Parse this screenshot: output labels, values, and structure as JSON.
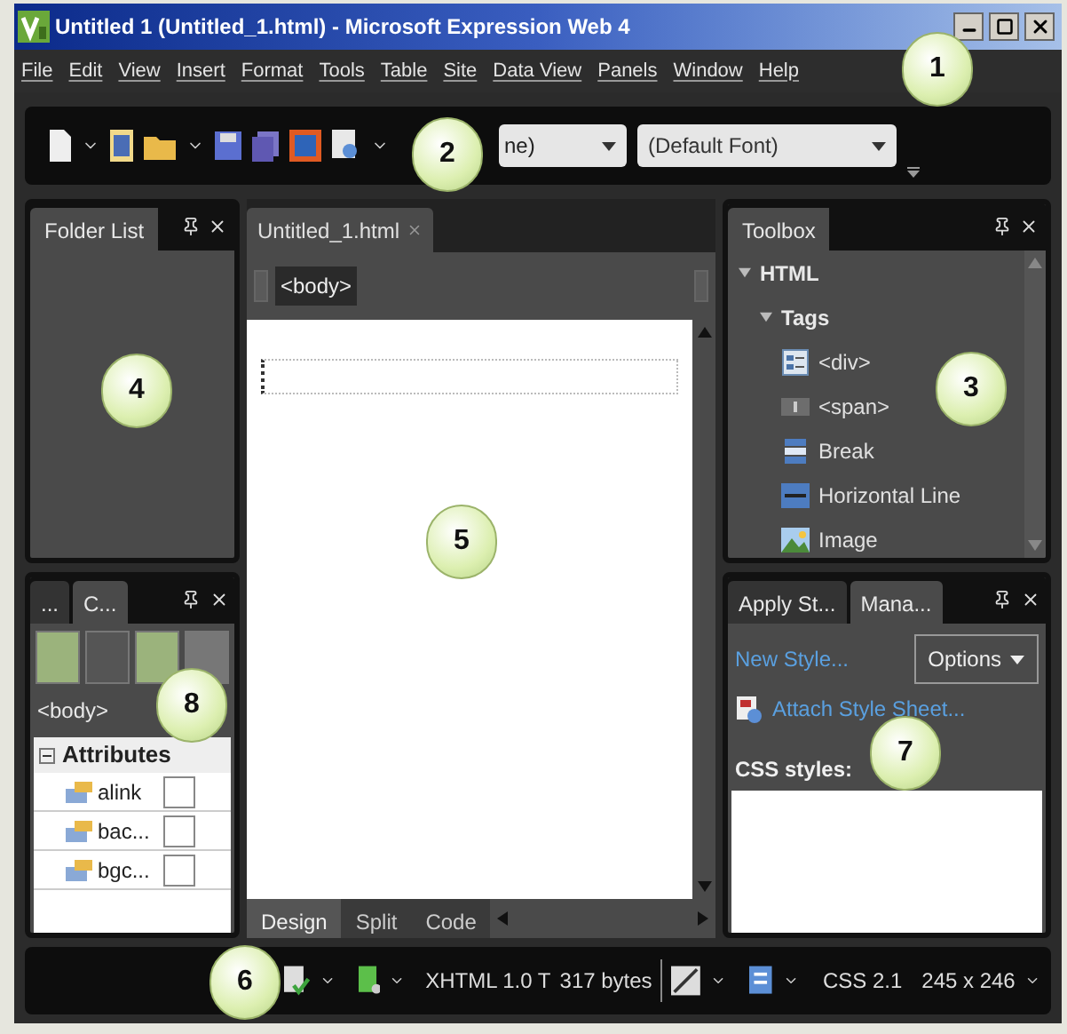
{
  "window": {
    "title": "Untitled 1 (Untitled_1.html) - Microsoft Expression Web 4"
  },
  "menu": [
    "File",
    "Edit",
    "View",
    "Insert",
    "Format",
    "Tools",
    "Table",
    "Site",
    "Data View",
    "Panels",
    "Window",
    "Help"
  ],
  "toolbar": {
    "style_dropdown": "ne)",
    "font_dropdown": "(Default Font)"
  },
  "folder_list": {
    "title": "Folder List"
  },
  "document": {
    "tab": "Untitled_1.html",
    "breadcrumb": "<body>",
    "view_tabs": [
      {
        "label": "Design",
        "selected": true
      },
      {
        "label": "Split",
        "selected": false
      },
      {
        "label": "Code",
        "selected": false
      }
    ]
  },
  "toolbox": {
    "title": "Toolbox",
    "tree": [
      {
        "label": "HTML",
        "expanded": true,
        "children": [
          {
            "label": "Tags",
            "expanded": true,
            "children": [
              {
                "label": "<div>"
              },
              {
                "label": "<span>"
              },
              {
                "label": "Break"
              },
              {
                "label": "Horizontal Line"
              },
              {
                "label": "Image"
              }
            ]
          }
        ]
      }
    ]
  },
  "tag_properties": {
    "tabs": [
      {
        "label": "...",
        "selected": false
      },
      {
        "label": "C...",
        "selected": true
      }
    ],
    "tag": "<body>",
    "section": {
      "label": "Attributes",
      "expanded": true
    },
    "rows": [
      {
        "name": "alink"
      },
      {
        "name": "bac..."
      },
      {
        "name": "bgc..."
      }
    ]
  },
  "styles_panel": {
    "tabs": [
      {
        "label": "Apply St...",
        "selected": false
      },
      {
        "label": "Mana...",
        "selected": true
      }
    ],
    "new_style": "New Style...",
    "options": "Options",
    "attach": "Attach Style Sheet...",
    "list_label": "CSS styles:"
  },
  "status_bar": {
    "doctype": "XHTML 1.0 T",
    "size": "317 bytes",
    "css": "CSS 2.1",
    "dimensions": "245 x 246"
  },
  "callouts": [
    "1",
    "2",
    "3",
    "4",
    "5",
    "6",
    "7",
    "8"
  ]
}
